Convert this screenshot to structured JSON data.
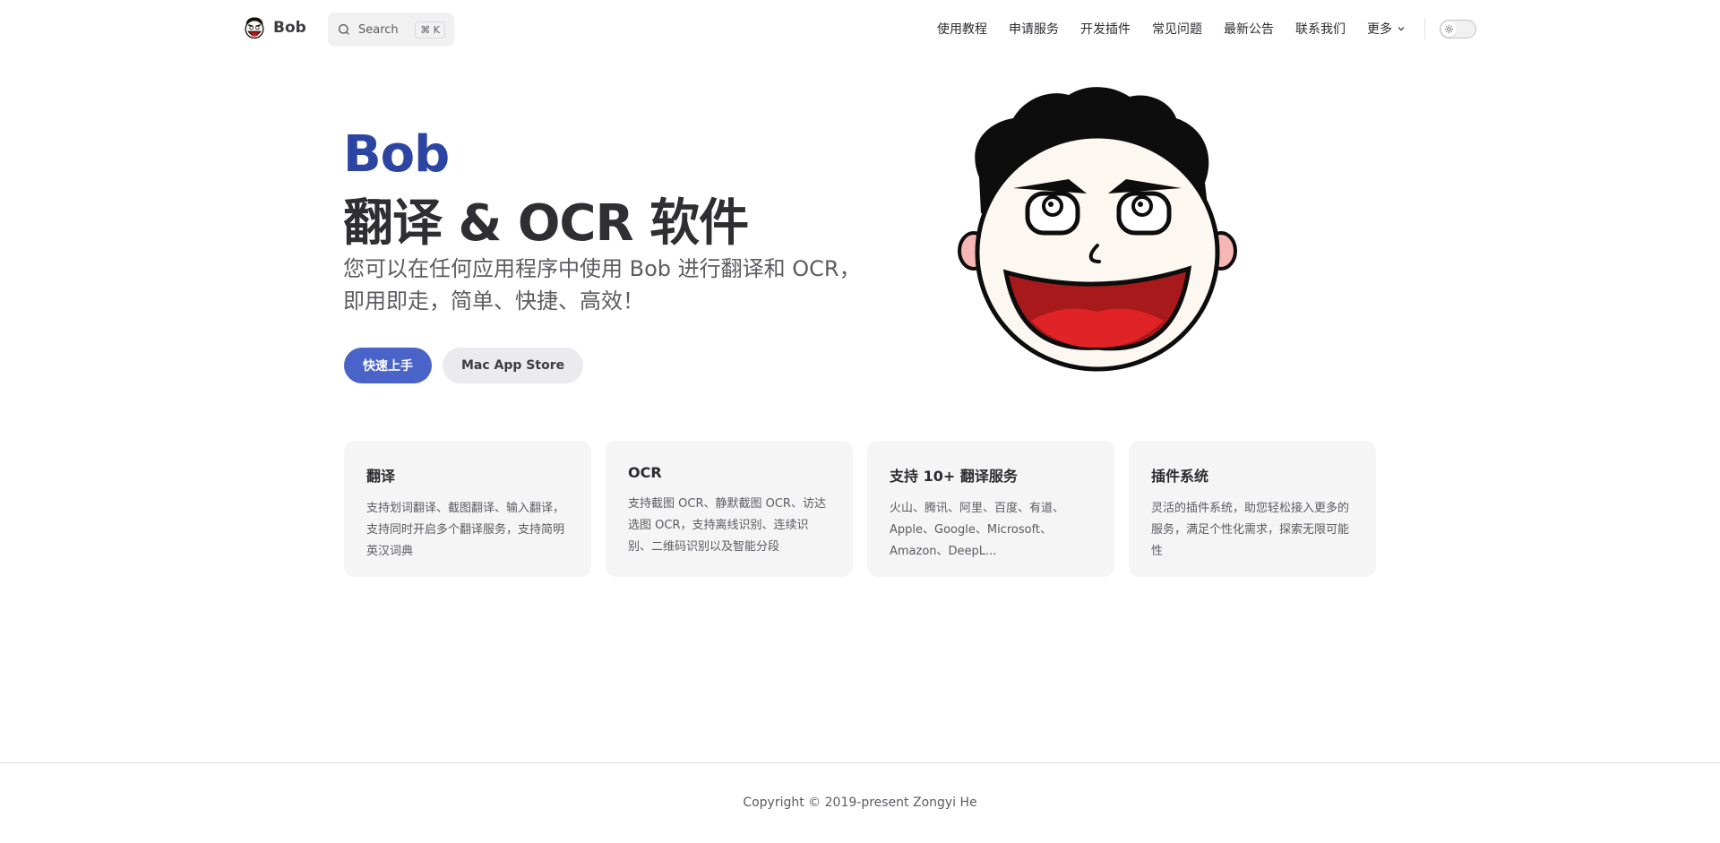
{
  "nav": {
    "brand": "Bob",
    "search_label": "Search",
    "search_kbd": "⌘ K",
    "items": [
      {
        "label": "使用教程"
      },
      {
        "label": "申请服务"
      },
      {
        "label": "开发插件"
      },
      {
        "label": "常见问题"
      },
      {
        "label": "最新公告"
      },
      {
        "label": "联系我们"
      },
      {
        "label": "更多"
      }
    ]
  },
  "hero": {
    "name": "Bob",
    "text": "翻译 & OCR 软件",
    "tagline": "您可以在任何应用程序中使用 Bob 进行翻译和 OCR，即用即走，简单、快捷、高效！",
    "actions": {
      "primary": "快速上手",
      "secondary": "Mac App Store"
    }
  },
  "features": [
    {
      "title": "翻译",
      "details": "支持划词翻译、截图翻译、输入翻译，支持同时开启多个翻译服务，支持简明英汉词典"
    },
    {
      "title": "OCR",
      "details": "支持截图 OCR、静默截图 OCR、访达选图 OCR，支持离线识别、连续识别、二维码识别以及智能分段"
    },
    {
      "title": "支持 10+ 翻译服务",
      "details": "火山、腾讯、阿里、百度、有道、Apple、Google、Microsoft、Amazon、DeepL..."
    },
    {
      "title": "插件系统",
      "details": "灵活的插件系统，助您轻松接入更多的服务，满足个性化需求，探索无限可能性"
    }
  ],
  "footer": {
    "copyright": "Copyright © 2019-present Zongyi He"
  },
  "colors": {
    "brand": "#2c45a3",
    "primary_button": "#4a63c9",
    "card_bg": "#f5f5f5"
  },
  "icons": [
    "bob-logo-icon",
    "search-icon",
    "chevron-down-icon",
    "sun-icon",
    "bob-mascot-icon"
  ]
}
